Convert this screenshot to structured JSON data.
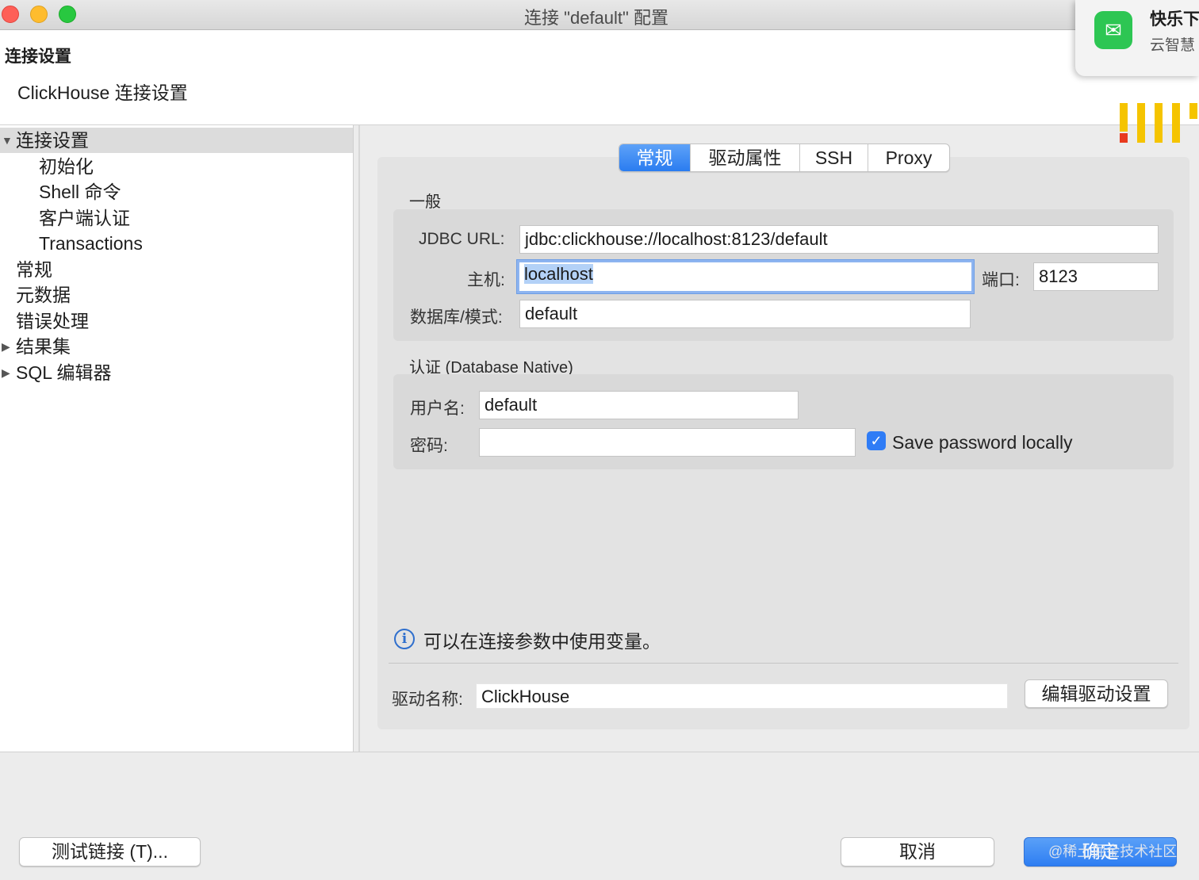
{
  "window": {
    "title": "连接 \"default\" 配置"
  },
  "header": {
    "title": "连接设置",
    "subtitle": "ClickHouse 连接设置"
  },
  "notification": {
    "app_icon": "wechat-icon",
    "title": "快乐下",
    "body": "云智慧"
  },
  "sidebar": {
    "items": [
      {
        "label": "连接设置",
        "expanded": true,
        "selected": true
      },
      {
        "label": "初始化"
      },
      {
        "label": "Shell 命令"
      },
      {
        "label": "客户端认证"
      },
      {
        "label": "Transactions"
      },
      {
        "label": "常规"
      },
      {
        "label": "元数据"
      },
      {
        "label": "错误处理"
      },
      {
        "label": "结果集",
        "expandable": true
      },
      {
        "label": "SQL 编辑器",
        "expandable": true
      }
    ]
  },
  "tabs": [
    {
      "label": "常规",
      "active": true
    },
    {
      "label": "驱动属性"
    },
    {
      "label": "SSH"
    },
    {
      "label": "Proxy"
    }
  ],
  "general": {
    "section": "一般",
    "jdbc_label": "JDBC URL:",
    "jdbc_value": "jdbc:clickhouse://localhost:8123/default",
    "host_label": "主机:",
    "host_value": "localhost",
    "port_label": "端口:",
    "port_value": "8123",
    "db_label": "数据库/模式:",
    "db_value": "default"
  },
  "auth": {
    "section": "认证 (Database Native)",
    "user_label": "用户名:",
    "user_value": "default",
    "password_label": "密码:",
    "password_value": "",
    "save_password_label": "Save password locally",
    "save_password_checked": true
  },
  "info": {
    "text": "可以在连接参数中使用变量。"
  },
  "driver": {
    "label": "驱动名称:",
    "value": "ClickHouse",
    "edit_button": "编辑驱动设置"
  },
  "footer": {
    "test_button": "测试链接 (T)...",
    "cancel_button": "取消",
    "ok_button": "确定",
    "watermark": "@稀土掘金技术社区"
  },
  "colors": {
    "accent": "#2e7ef2",
    "selection": "#b3d1f7"
  }
}
